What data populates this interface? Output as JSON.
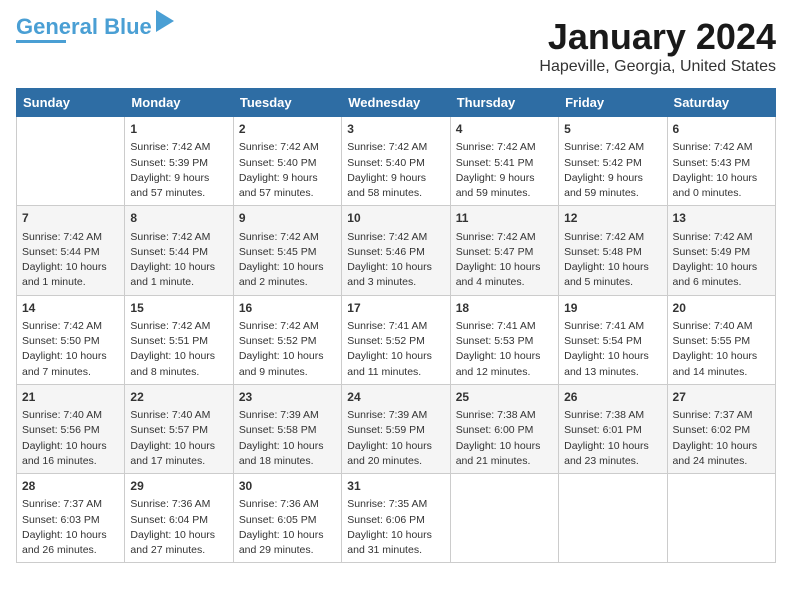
{
  "logo": {
    "line1": "General",
    "line2": "Blue"
  },
  "title": "January 2024",
  "subtitle": "Hapeville, Georgia, United States",
  "days": [
    "Sunday",
    "Monday",
    "Tuesday",
    "Wednesday",
    "Thursday",
    "Friday",
    "Saturday"
  ],
  "weeks": [
    [
      {
        "num": "",
        "content": ""
      },
      {
        "num": "1",
        "content": "Sunrise: 7:42 AM\nSunset: 5:39 PM\nDaylight: 9 hours\nand 57 minutes."
      },
      {
        "num": "2",
        "content": "Sunrise: 7:42 AM\nSunset: 5:40 PM\nDaylight: 9 hours\nand 57 minutes."
      },
      {
        "num": "3",
        "content": "Sunrise: 7:42 AM\nSunset: 5:40 PM\nDaylight: 9 hours\nand 58 minutes."
      },
      {
        "num": "4",
        "content": "Sunrise: 7:42 AM\nSunset: 5:41 PM\nDaylight: 9 hours\nand 59 minutes."
      },
      {
        "num": "5",
        "content": "Sunrise: 7:42 AM\nSunset: 5:42 PM\nDaylight: 9 hours\nand 59 minutes."
      },
      {
        "num": "6",
        "content": "Sunrise: 7:42 AM\nSunset: 5:43 PM\nDaylight: 10 hours\nand 0 minutes."
      }
    ],
    [
      {
        "num": "7",
        "content": "Sunrise: 7:42 AM\nSunset: 5:44 PM\nDaylight: 10 hours\nand 1 minute."
      },
      {
        "num": "8",
        "content": "Sunrise: 7:42 AM\nSunset: 5:44 PM\nDaylight: 10 hours\nand 1 minute."
      },
      {
        "num": "9",
        "content": "Sunrise: 7:42 AM\nSunset: 5:45 PM\nDaylight: 10 hours\nand 2 minutes."
      },
      {
        "num": "10",
        "content": "Sunrise: 7:42 AM\nSunset: 5:46 PM\nDaylight: 10 hours\nand 3 minutes."
      },
      {
        "num": "11",
        "content": "Sunrise: 7:42 AM\nSunset: 5:47 PM\nDaylight: 10 hours\nand 4 minutes."
      },
      {
        "num": "12",
        "content": "Sunrise: 7:42 AM\nSunset: 5:48 PM\nDaylight: 10 hours\nand 5 minutes."
      },
      {
        "num": "13",
        "content": "Sunrise: 7:42 AM\nSunset: 5:49 PM\nDaylight: 10 hours\nand 6 minutes."
      }
    ],
    [
      {
        "num": "14",
        "content": "Sunrise: 7:42 AM\nSunset: 5:50 PM\nDaylight: 10 hours\nand 7 minutes."
      },
      {
        "num": "15",
        "content": "Sunrise: 7:42 AM\nSunset: 5:51 PM\nDaylight: 10 hours\nand 8 minutes."
      },
      {
        "num": "16",
        "content": "Sunrise: 7:42 AM\nSunset: 5:52 PM\nDaylight: 10 hours\nand 9 minutes."
      },
      {
        "num": "17",
        "content": "Sunrise: 7:41 AM\nSunset: 5:52 PM\nDaylight: 10 hours\nand 11 minutes."
      },
      {
        "num": "18",
        "content": "Sunrise: 7:41 AM\nSunset: 5:53 PM\nDaylight: 10 hours\nand 12 minutes."
      },
      {
        "num": "19",
        "content": "Sunrise: 7:41 AM\nSunset: 5:54 PM\nDaylight: 10 hours\nand 13 minutes."
      },
      {
        "num": "20",
        "content": "Sunrise: 7:40 AM\nSunset: 5:55 PM\nDaylight: 10 hours\nand 14 minutes."
      }
    ],
    [
      {
        "num": "21",
        "content": "Sunrise: 7:40 AM\nSunset: 5:56 PM\nDaylight: 10 hours\nand 16 minutes."
      },
      {
        "num": "22",
        "content": "Sunrise: 7:40 AM\nSunset: 5:57 PM\nDaylight: 10 hours\nand 17 minutes."
      },
      {
        "num": "23",
        "content": "Sunrise: 7:39 AM\nSunset: 5:58 PM\nDaylight: 10 hours\nand 18 minutes."
      },
      {
        "num": "24",
        "content": "Sunrise: 7:39 AM\nSunset: 5:59 PM\nDaylight: 10 hours\nand 20 minutes."
      },
      {
        "num": "25",
        "content": "Sunrise: 7:38 AM\nSunset: 6:00 PM\nDaylight: 10 hours\nand 21 minutes."
      },
      {
        "num": "26",
        "content": "Sunrise: 7:38 AM\nSunset: 6:01 PM\nDaylight: 10 hours\nand 23 minutes."
      },
      {
        "num": "27",
        "content": "Sunrise: 7:37 AM\nSunset: 6:02 PM\nDaylight: 10 hours\nand 24 minutes."
      }
    ],
    [
      {
        "num": "28",
        "content": "Sunrise: 7:37 AM\nSunset: 6:03 PM\nDaylight: 10 hours\nand 26 minutes."
      },
      {
        "num": "29",
        "content": "Sunrise: 7:36 AM\nSunset: 6:04 PM\nDaylight: 10 hours\nand 27 minutes."
      },
      {
        "num": "30",
        "content": "Sunrise: 7:36 AM\nSunset: 6:05 PM\nDaylight: 10 hours\nand 29 minutes."
      },
      {
        "num": "31",
        "content": "Sunrise: 7:35 AM\nSunset: 6:06 PM\nDaylight: 10 hours\nand 31 minutes."
      },
      {
        "num": "",
        "content": ""
      },
      {
        "num": "",
        "content": ""
      },
      {
        "num": "",
        "content": ""
      }
    ]
  ]
}
